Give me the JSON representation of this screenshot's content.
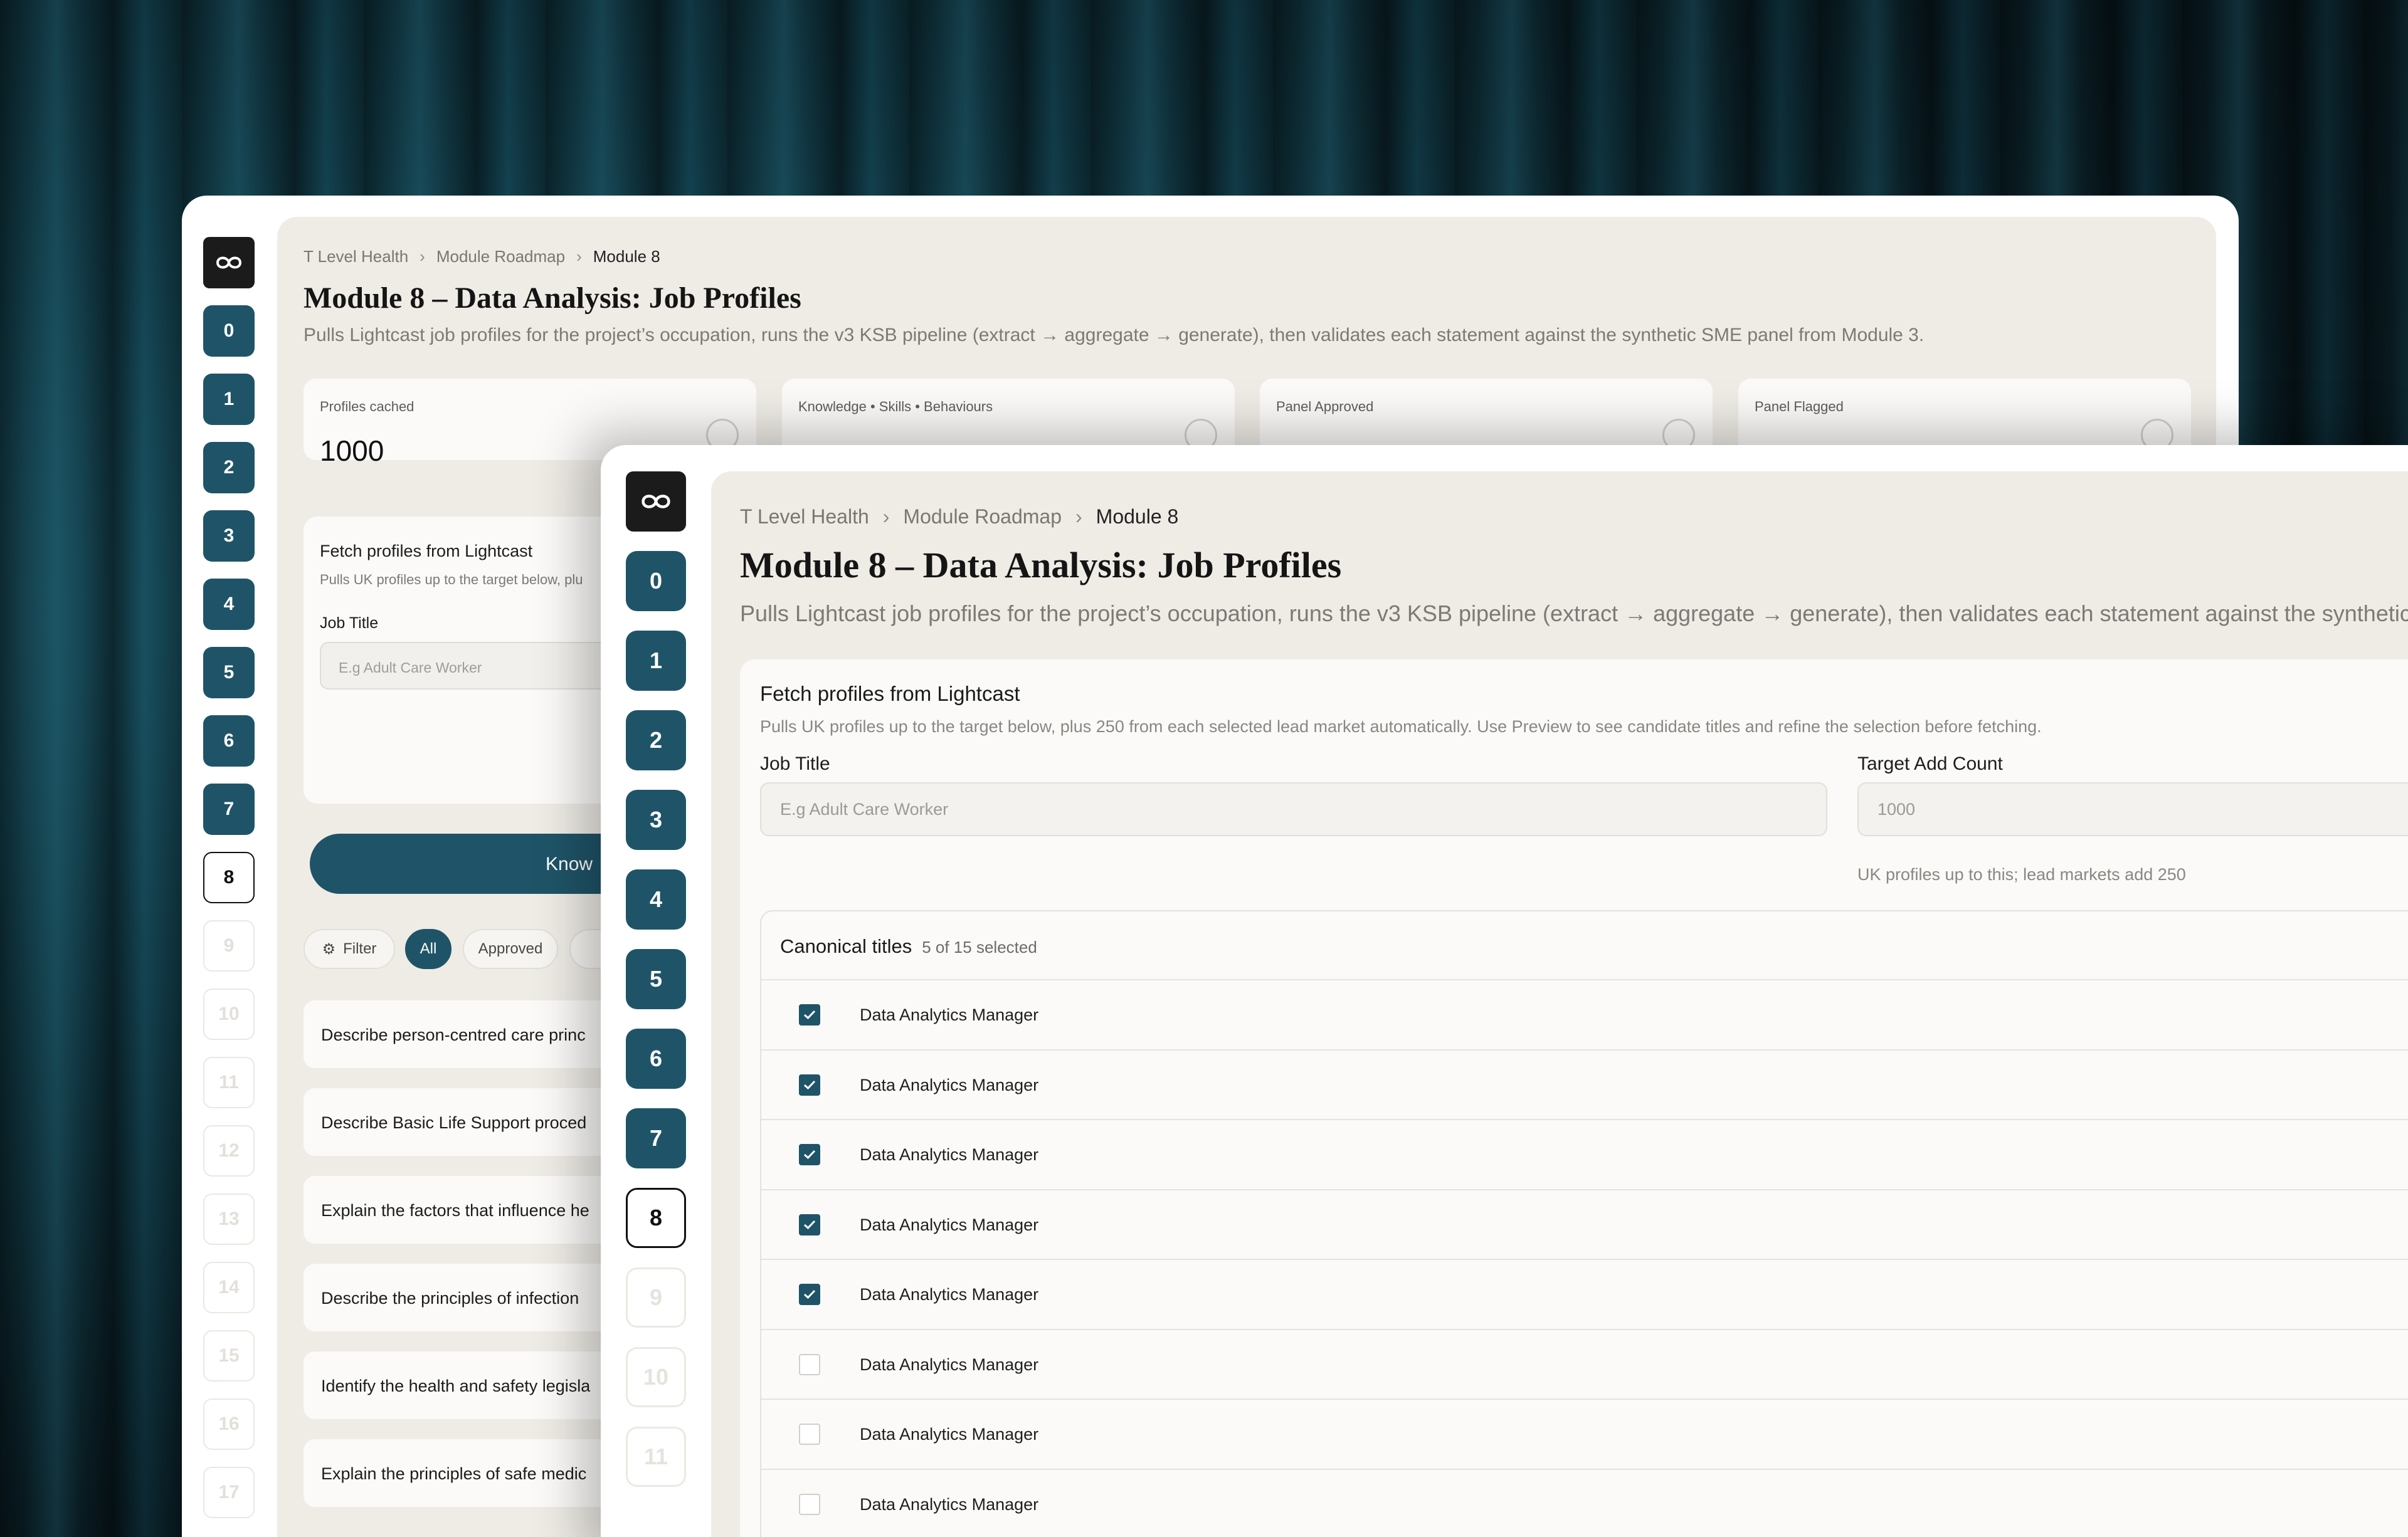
{
  "back": {
    "breadcrumb": [
      "T Level Health",
      "Module Roadmap",
      "Module 8"
    ],
    "title": "Module 8 – Data Analysis: Job Profiles",
    "description": "Pulls Lightcast job profiles for the project’s occupation, runs the v3 KSB pipeline (extract → aggregate → generate), then validates each statement against the synthetic SME panel from Module 3.",
    "rail_numbers": [
      "0",
      "1",
      "2",
      "3",
      "4",
      "5",
      "6",
      "7",
      "8",
      "9",
      "10",
      "11",
      "12",
      "13",
      "14",
      "15",
      "16",
      "17"
    ],
    "stats": [
      {
        "label": "Profiles cached",
        "value": "1000",
        "icon": "folder-icon"
      },
      {
        "label": "Knowledge • Skills • Behaviours",
        "value": "",
        "icon": "pie-chart-icon"
      },
      {
        "label": "Panel Approved",
        "value": "",
        "icon": "check-circle-icon"
      },
      {
        "label": "Panel Flagged",
        "value": "",
        "icon": "alert-circle-icon"
      }
    ],
    "fetch": {
      "title": "Fetch profiles from Lightcast",
      "description": "Pulls UK profiles up to the target below, plu",
      "job_title_label": "Job Title",
      "job_title_placeholder": "E.g Adult Care Worker"
    },
    "knowledge_button": "Know",
    "filter": {
      "label": "Filter",
      "chips": [
        "All",
        "Approved",
        "F"
      ]
    },
    "statements": [
      "Describe person-centred care princ",
      "Describe Basic Life Support proced",
      "Explain the factors that influence he",
      "Describe the principles of infection",
      "Identify the health and safety legisla",
      "Explain the principles of safe medic"
    ]
  },
  "front": {
    "breadcrumb": [
      "T Level Health",
      "Module Roadmap",
      "Module 8"
    ],
    "title": "Module 8 – Data Analysis: Job Profiles",
    "description": "Pulls Lightcast job profiles for the project’s occupation, runs the v3 KSB pipeline (extract → aggregate → generate), then validates each statement against the synthetic",
    "rail_numbers": [
      "0",
      "1",
      "2",
      "3",
      "4",
      "5",
      "6",
      "7",
      "8",
      "9",
      "10",
      "11"
    ],
    "fetch": {
      "title": "Fetch profiles from Lightcast",
      "description": "Pulls UK profiles up to the target below, plus 250 from each selected lead market automatically. Use Preview to see candidate titles and refine the selection before fetching.",
      "job_title_label": "Job Title",
      "job_title_placeholder": "E.g Adult Care Worker",
      "target_label": "Target Add Count",
      "target_value": "1000",
      "target_hint": "UK profiles up to this; lead markets add 250"
    },
    "canonical": {
      "title": "Canonical titles",
      "count": "5 of 15 selected",
      "items": [
        {
          "label": "Data Analytics Manager",
          "checked": true
        },
        {
          "label": "Data Analytics Manager",
          "checked": true
        },
        {
          "label": "Data Analytics Manager",
          "checked": true
        },
        {
          "label": "Data Analytics Manager",
          "checked": true
        },
        {
          "label": "Data Analytics Manager",
          "checked": true
        },
        {
          "label": "Data Analytics Manager",
          "checked": false
        },
        {
          "label": "Data Analytics Manager",
          "checked": false
        },
        {
          "label": "Data Analytics Manager",
          "checked": false
        }
      ]
    }
  },
  "colors": {
    "accent": "#1f5468",
    "panel": "#efece6",
    "card": "#fbfaf8"
  }
}
